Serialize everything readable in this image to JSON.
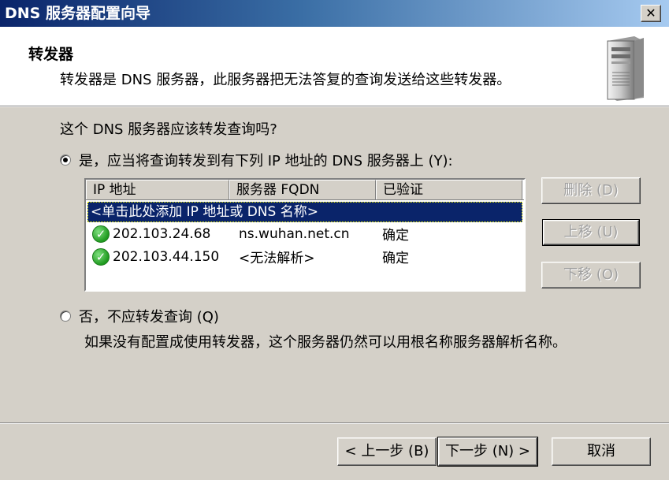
{
  "window": {
    "title": "DNS 服务器配置向导",
    "close_glyph": "✕"
  },
  "header": {
    "title": "转发器",
    "description": "转发器是 DNS 服务器，此服务器把无法答复的查询发送给这些转发器。"
  },
  "question": "这个 DNS 服务器应该转发查询吗?",
  "option_yes": {
    "label": "是，应当将查询转发到有下列 IP 地址的 DNS 服务器上 (Y):",
    "selected": true
  },
  "forwarders": {
    "columns": [
      "IP 地址",
      "服务器 FQDN",
      "已验证"
    ],
    "add_row": "<单击此处添加 IP 地址或 DNS 名称>",
    "rows": [
      {
        "ip": "202.103.24.68",
        "fqdn": "ns.wuhan.net.cn",
        "verified": "确定"
      },
      {
        "ip": "202.103.44.150",
        "fqdn": "<无法解析>",
        "verified": "确定"
      }
    ]
  },
  "side_buttons": {
    "delete": "删除 (D)",
    "move_up": "上移 (U)",
    "move_down": "下移 (O)"
  },
  "option_no": {
    "label": "否，不应转发查询 (Q)",
    "selected": false,
    "description": "如果没有配置成使用转发器，这个服务器仍然可以用根名称服务器解析名称。"
  },
  "footer": {
    "back": "< 上一步 (B)",
    "next": "下一步 (N) >",
    "cancel": "取消"
  }
}
